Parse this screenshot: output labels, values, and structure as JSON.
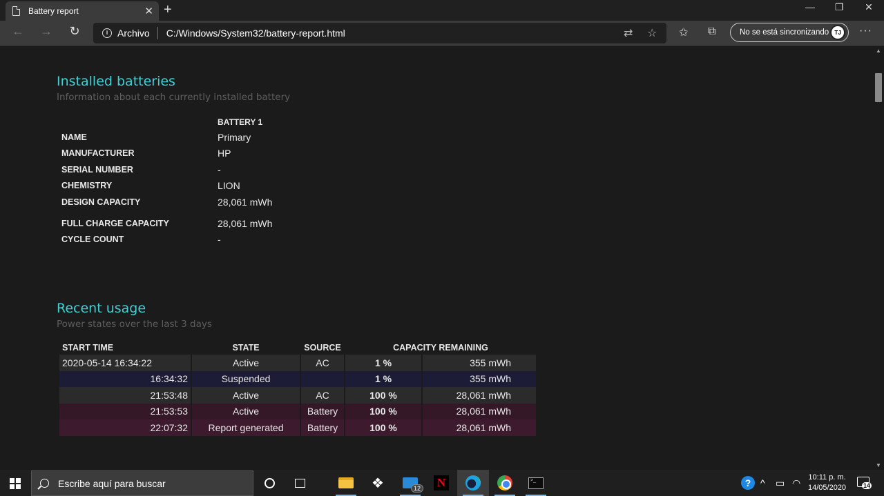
{
  "browser": {
    "tab_title": "Battery report",
    "new_tab": "+",
    "window_controls": {
      "minimize": "—",
      "restore": "❐",
      "close": "✕"
    },
    "site_label": "Archivo",
    "url": "C:/Windows/System32/battery-report.html",
    "sync_label": "No se está sincronizando",
    "avatar_initials": "ᵀᴶ",
    "more": "···"
  },
  "installed": {
    "title": "Installed batteries",
    "subtitle": "Information about each currently installed battery",
    "column_header": "BATTERY 1",
    "rows": [
      {
        "label": "NAME",
        "value": "Primary"
      },
      {
        "label": "MANUFACTURER",
        "value": "HP"
      },
      {
        "label": "SERIAL NUMBER",
        "value": "-"
      },
      {
        "label": "CHEMISTRY",
        "value": "LION"
      },
      {
        "label": "DESIGN CAPACITY",
        "value": "28,061 mWh"
      },
      {
        "label": "FULL CHARGE CAPACITY",
        "value": "28,061 mWh"
      },
      {
        "label": "CYCLE COUNT",
        "value": "-"
      }
    ]
  },
  "usage": {
    "title": "Recent usage",
    "subtitle": "Power states over the last 3 days",
    "headers": {
      "start_time": "START TIME",
      "state": "STATE",
      "source": "SOURCE",
      "capacity": "CAPACITY REMAINING"
    },
    "rows": [
      {
        "start_time": "2020-05-14  16:34:22",
        "state": "Active",
        "source": "AC",
        "percent": "1 %",
        "mwh": "355 mWh"
      },
      {
        "start_time": "16:34:32",
        "state": "Suspended",
        "source": "",
        "percent": "1 %",
        "mwh": "355 mWh"
      },
      {
        "start_time": "21:53:48",
        "state": "Active",
        "source": "AC",
        "percent": "100 %",
        "mwh": "28,061 mWh"
      },
      {
        "start_time": "21:53:53",
        "state": "Active",
        "source": "Battery",
        "percent": "100 %",
        "mwh": "28,061 mWh"
      },
      {
        "start_time": "22:07:32",
        "state": "Report generated",
        "source": "Battery",
        "percent": "100 %",
        "mwh": "28,061 mWh"
      }
    ]
  },
  "taskbar": {
    "search_placeholder": "Escribe aquí para buscar",
    "mail_badge": "12",
    "clock_time": "10:11 p. m.",
    "clock_date": "14/05/2020",
    "notification_count": "14"
  },
  "colors": {
    "heading_accent": "#3fd0d6",
    "row_dark": "#2b2b2b",
    "row_navy": "#1c1c36",
    "row_wine": "#351827"
  }
}
